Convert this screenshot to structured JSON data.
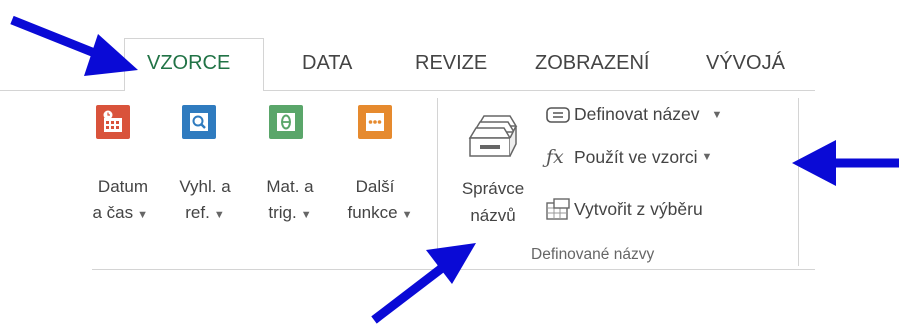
{
  "ribbon": {
    "tabs": [
      {
        "label": "VZORCE",
        "active": true
      },
      {
        "label": "DATA",
        "active": false
      },
      {
        "label": "REVIZE",
        "active": false
      },
      {
        "label": "ZOBRAZENÍ",
        "active": false
      },
      {
        "label": "VÝVOJÁ",
        "active": false
      }
    ],
    "function_library": {
      "buttons": [
        {
          "line1": "Datum",
          "line2": "a čas",
          "icon": "calendar-clock-icon",
          "color": "#d9533b"
        },
        {
          "line1": "Vyhl. a",
          "line2": "ref.",
          "icon": "lookup-magnifier-icon",
          "color": "#2f7bbf"
        },
        {
          "line1": "Mat. a",
          "line2": "trig.",
          "icon": "theta-icon",
          "color": "#5aa66a"
        },
        {
          "line1": "Další",
          "line2": "funkce",
          "icon": "more-functions-icon",
          "color": "#e68a2e"
        }
      ]
    },
    "defined_names": {
      "manager": {
        "line1": "Správce",
        "line2": "názvů"
      },
      "define_name": "Definovat název",
      "use_in_formula": "Použít ve vzorci",
      "create_from_selection": "Vytvořit z výběru",
      "group_label": "Definované názvy"
    }
  },
  "annotations": {
    "arrow_color": "#0a0ad6",
    "arrows": [
      "arrow-to-vzorce-tab",
      "arrow-to-pouzit-ve-vzorci",
      "arrow-to-spravce-nazvu"
    ]
  }
}
